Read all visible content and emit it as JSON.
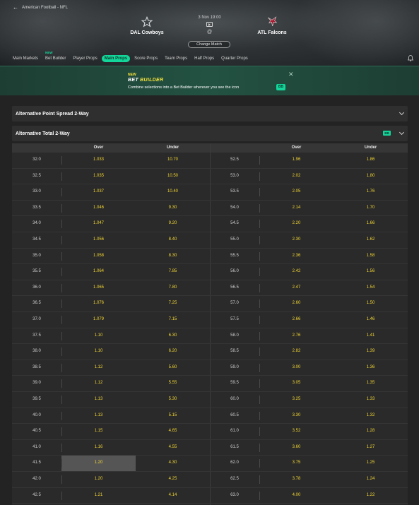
{
  "breadcrumb": {
    "text": "American Football - NFL"
  },
  "match": {
    "time": "3 Nov 19:00",
    "at": "@",
    "home": "DAL Cowboys",
    "away": "ATL Falcons",
    "change_label": "Change Match"
  },
  "tabs": [
    {
      "label": "Main Markets",
      "active": false
    },
    {
      "label": "Bet Builder",
      "active": false,
      "tag": "NEW"
    },
    {
      "label": "Player Props",
      "active": false
    },
    {
      "label": "Main Props",
      "active": true
    },
    {
      "label": "Score Props",
      "active": false
    },
    {
      "label": "Team Props",
      "active": false
    },
    {
      "label": "Half Props",
      "active": false
    },
    {
      "label": "Quarter Props",
      "active": false
    }
  ],
  "promo": {
    "new_label": "NEW",
    "title_a": "BET ",
    "title_b": "BUILDER",
    "description": "Combine selections into a Bet Builder wherever you see the icon",
    "badge": "BB"
  },
  "markets": {
    "spread_title": "Alternative Point Spread 2-Way",
    "total_title": "Alternative Total 2-Way",
    "total_badge": "BB"
  },
  "columns": {
    "over": "Over",
    "under": "Under"
  },
  "rows": [
    {
      "l1": "32.0",
      "o1": "1.033",
      "u1": "10.70",
      "l2": "52.5",
      "o2": "1.96",
      "u2": "1.86"
    },
    {
      "l1": "32.5",
      "o1": "1.035",
      "u1": "10.50",
      "l2": "53.0",
      "o2": "2.02",
      "u2": "1.80"
    },
    {
      "l1": "33.0",
      "o1": "1.037",
      "u1": "10.40",
      "l2": "53.5",
      "o2": "2.05",
      "u2": "1.76"
    },
    {
      "l1": "33.5",
      "o1": "1.046",
      "u1": "9.30",
      "l2": "54.0",
      "o2": "2.14",
      "u2": "1.70"
    },
    {
      "l1": "34.0",
      "o1": "1.047",
      "u1": "9.20",
      "l2": "54.5",
      "o2": "2.20",
      "u2": "1.66"
    },
    {
      "l1": "34.5",
      "o1": "1.056",
      "u1": "8.40",
      "l2": "55.0",
      "o2": "2.30",
      "u2": "1.62"
    },
    {
      "l1": "35.0",
      "o1": "1.058",
      "u1": "8.30",
      "l2": "55.5",
      "o2": "2.36",
      "u2": "1.58"
    },
    {
      "l1": "35.5",
      "o1": "1.064",
      "u1": "7.85",
      "l2": "56.0",
      "o2": "2.42",
      "u2": "1.56"
    },
    {
      "l1": "36.0",
      "o1": "1.065",
      "u1": "7.80",
      "l2": "56.5",
      "o2": "2.47",
      "u2": "1.54"
    },
    {
      "l1": "36.5",
      "o1": "1.076",
      "u1": "7.25",
      "l2": "57.0",
      "o2": "2.60",
      "u2": "1.50"
    },
    {
      "l1": "37.0",
      "o1": "1.079",
      "u1": "7.15",
      "l2": "57.5",
      "o2": "2.66",
      "u2": "1.46"
    },
    {
      "l1": "37.5",
      "o1": "1.10",
      "u1": "6.30",
      "l2": "58.0",
      "o2": "2.76",
      "u2": "1.41"
    },
    {
      "l1": "38.0",
      "o1": "1.10",
      "u1": "6.20",
      "l2": "58.5",
      "o2": "2.82",
      "u2": "1.39"
    },
    {
      "l1": "38.5",
      "o1": "1.12",
      "u1": "5.60",
      "l2": "59.0",
      "o2": "3.00",
      "u2": "1.36"
    },
    {
      "l1": "39.0",
      "o1": "1.12",
      "u1": "5.55",
      "l2": "59.5",
      "o2": "3.05",
      "u2": "1.35"
    },
    {
      "l1": "39.5",
      "o1": "1.13",
      "u1": "5.30",
      "l2": "60.0",
      "o2": "3.25",
      "u2": "1.33"
    },
    {
      "l1": "40.0",
      "o1": "1.13",
      "u1": "5.15",
      "l2": "60.5",
      "o2": "3.30",
      "u2": "1.32"
    },
    {
      "l1": "40.5",
      "o1": "1.15",
      "u1": "4.65",
      "l2": "61.0",
      "o2": "3.52",
      "u2": "1.28"
    },
    {
      "l1": "41.0",
      "o1": "1.16",
      "u1": "4.55",
      "l2": "61.5",
      "o2": "3.60",
      "u2": "1.27"
    },
    {
      "l1": "41.5",
      "o1": "1.20",
      "u1": "4.30",
      "l2": "62.0",
      "o2": "3.75",
      "u2": "1.25",
      "selected": true
    },
    {
      "l1": "42.0",
      "o1": "1.20",
      "u1": "4.25",
      "l2": "62.5",
      "o2": "3.78",
      "u2": "1.24"
    },
    {
      "l1": "42.5",
      "o1": "1.21",
      "u1": "4.14",
      "l2": "63.0",
      "o2": "4.00",
      "u2": "1.22"
    }
  ],
  "colors": {
    "accent": "#13d69a",
    "odds": "#f1d534",
    "promo_bg": "#235242"
  }
}
